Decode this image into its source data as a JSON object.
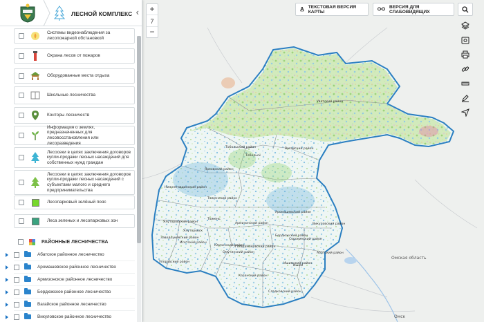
{
  "panel": {
    "title": "ЛЕСНОЙ КОМПЛЕКС",
    "collapse_icon": "chevron-left-icon",
    "layers": [
      {
        "label": "Системы видеонаблюдения за лесопожарной обстановкой",
        "icon": "camera-icon"
      },
      {
        "label": "Охрана лесов от пожаров",
        "icon": "fire-tower-icon"
      },
      {
        "label": "Оборудованные места отдыха",
        "icon": "rest-area-icon"
      },
      {
        "label": "Школьные лесничества",
        "icon": "school-icon"
      },
      {
        "label": "Конторы лесничеств",
        "icon": "pin-icon"
      },
      {
        "label": "Информация о землях, предназначенных для лесовосстановления или лесоразведения",
        "icon": "seedling-icon"
      },
      {
        "label": "Лесосеки в целях заключения договоров купли-продажи лесных насаждений для собственных нужд граждан",
        "icon": "tree-blue-icon"
      },
      {
        "label": "Лесосеки в целях заключения договоров купли-продажи лесных насаждений с субъектами малого и среднего предпринимательства",
        "icon": "tree-green-icon"
      },
      {
        "label": "Лесопарковый зелёный пояс",
        "icon": "swatch-icon",
        "color": "#77d82b"
      },
      {
        "label": "Леса зеленых и лесопарковых зон",
        "icon": "swatch-icon",
        "color": "#3aa37f"
      }
    ],
    "section": {
      "label": "РАЙОННЫЕ ЛЕСНИЧЕСТВА",
      "icon": "palette-icon"
    },
    "forestries": [
      "Абатское районное лесничество",
      "Аромашевское районное лесничество",
      "Армизонское районное лесничество",
      "Бердюжское районное лесничество",
      "Вагайское районное лесничество",
      "Викуловское районное лесничество"
    ]
  },
  "zoom": {
    "plus": "+",
    "level": "7",
    "minus": "−"
  },
  "top_buttons": {
    "text_version": "ТЕКСТОВАЯ ВЕРСИЯ КАРТЫ",
    "accessible_version": "ВЕРСИЯ ДЛЯ СЛАБОВИДЯЩИХ"
  },
  "toolbar": [
    "layers-icon",
    "screenshot-icon",
    "print-icon",
    "link-icon",
    "ruler-icon",
    "draw-icon",
    "locate-icon"
  ],
  "map": {
    "districts": [
      "Уватский район",
      "Тобольский район",
      "Вагайский район",
      "Ярковский район",
      "Нижнетавдинский район",
      "Тюменский район",
      "Ялуторовский район",
      "Заводоуковский район",
      "Исетский район",
      "Упоровский район",
      "Армизонский район",
      "Бердюжский район",
      "Голышмановский район",
      "Омутинский район",
      "Юргинский район",
      "Аромашевский район",
      "Викуловский район",
      "Сорокинский район",
      "Ишимский район",
      "Абатский район",
      "Казанский район",
      "Сладковский район",
      "Тобольск",
      "Тюмень",
      "Ялуторовск",
      "Ишим"
    ],
    "places": [
      "Омская область",
      "Омск"
    ],
    "colors": {
      "region_border": "#2b7fc1",
      "land": "#f4f8f7",
      "forest_green": "#a8d98a",
      "forest_blue": "#7ec4e8"
    }
  }
}
